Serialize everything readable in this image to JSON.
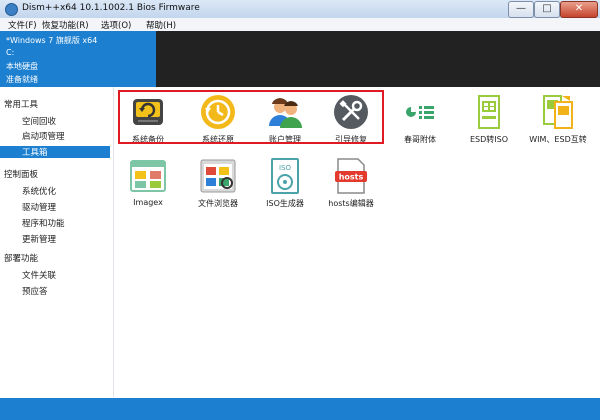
{
  "window": {
    "title": "Dism++x64 10.1.1002.1 Bios Firmware"
  },
  "menu": [
    "文件(F)",
    "恢复功能(R)",
    "选项(O)",
    "帮助(H)"
  ],
  "session": {
    "system": "*Windows 7 旗舰版 x64",
    "drive": "C:",
    "disk": "本地硬盘",
    "status": "准备就绪"
  },
  "sidebar": {
    "groups": [
      {
        "title": "常用工具",
        "items": [
          "空间回收",
          "启动项管理",
          "工具箱"
        ]
      },
      {
        "title": "控制面板",
        "items": [
          "系统优化",
          "驱动管理",
          "程序和功能",
          "更新管理"
        ]
      },
      {
        "title": "部署功能",
        "items": [
          "文件关联",
          "预应答"
        ]
      }
    ],
    "selected": "工具箱"
  },
  "tools": {
    "row1": [
      "系统备份",
      "系统还原",
      "账户管理",
      "引导修复",
      "春哥附体",
      "ESD转ISO",
      "WIM、ESD互转"
    ],
    "row2": [
      "Imagex",
      "文件浏览器",
      "ISO生成器",
      "hosts编辑器"
    ]
  },
  "icons": {
    "iso_text": "ISO",
    "hosts_text": "hosts"
  },
  "colors": {
    "accent": "#1d7fd0",
    "highlight": "#e01a22",
    "titlebar": "#c3d6ee"
  }
}
